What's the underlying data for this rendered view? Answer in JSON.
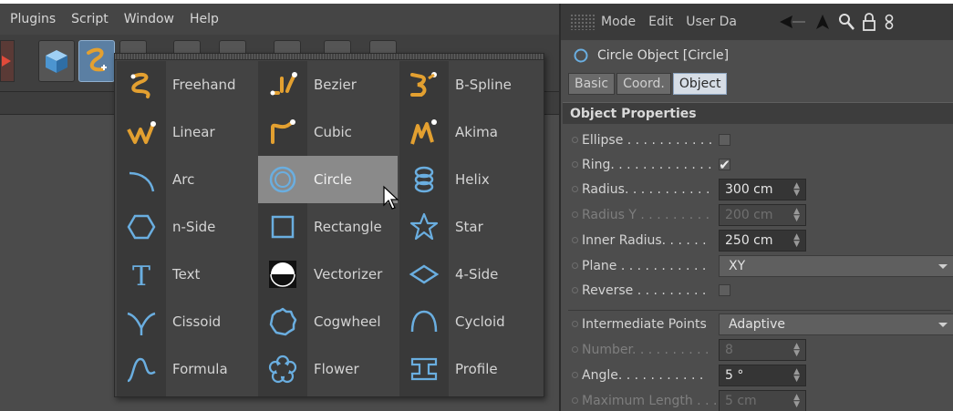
{
  "menubar": {
    "items": [
      "Plugins",
      "Script",
      "Window",
      "Help"
    ]
  },
  "spline_menu": {
    "columns": [
      {
        "items": [
          {
            "label": "Freehand",
            "icon": "freehand-spline-icon"
          },
          {
            "label": "Linear",
            "icon": "linear-spline-icon"
          },
          {
            "label": "Arc",
            "icon": "arc-icon"
          },
          {
            "label": "n-Side",
            "icon": "n-side-icon"
          },
          {
            "label": "Text",
            "icon": "text-icon"
          },
          {
            "label": "Cissoid",
            "icon": "cissoid-icon"
          },
          {
            "label": "Formula",
            "icon": "formula-icon"
          }
        ]
      },
      {
        "items": [
          {
            "label": "Bezier",
            "icon": "bezier-spline-icon"
          },
          {
            "label": "Cubic",
            "icon": "cubic-spline-icon"
          },
          {
            "label": "Circle",
            "icon": "circle-icon",
            "hovered": true
          },
          {
            "label": "Rectangle",
            "icon": "rectangle-icon"
          },
          {
            "label": "Vectorizer",
            "icon": "vectorizer-icon"
          },
          {
            "label": "Cogwheel",
            "icon": "cogwheel-icon"
          },
          {
            "label": "Flower",
            "icon": "flower-icon"
          }
        ]
      },
      {
        "items": [
          {
            "label": "B-Spline",
            "icon": "b-spline-icon"
          },
          {
            "label": "Akima",
            "icon": "akima-spline-icon"
          },
          {
            "label": "Helix",
            "icon": "helix-icon"
          },
          {
            "label": "Star",
            "icon": "star-icon"
          },
          {
            "label": "4-Side",
            "icon": "four-side-icon"
          },
          {
            "label": "Cycloid",
            "icon": "cycloid-icon"
          },
          {
            "label": "Profile",
            "icon": "profile-icon"
          }
        ]
      }
    ]
  },
  "attributes": {
    "header_menu": [
      "Mode",
      "Edit",
      "User Da"
    ],
    "object_title": "Circle Object [Circle]",
    "tabs": [
      {
        "label": "Basic",
        "active": false
      },
      {
        "label": "Coord.",
        "active": false
      },
      {
        "label": "Object",
        "active": true
      }
    ],
    "section_title": "Object Properties",
    "props": {
      "ellipse": {
        "label": "Ellipse . . . . . . . . . . .",
        "checked": false
      },
      "ring": {
        "label": "Ring. . . . . . . . . . . . .",
        "checked": true,
        "check_glyph": "✔"
      },
      "radius": {
        "label": "Radius. . . . . . . . . . .",
        "value": "300 cm"
      },
      "radius_y": {
        "label": "Radius Y . . . . . . . . .",
        "value": "200 cm",
        "disabled": true
      },
      "inner_radius": {
        "label": "Inner Radius. . . . . .",
        "value": "250 cm"
      },
      "plane": {
        "label": "Plane . . . . . . . . . . .",
        "value": "XY"
      },
      "reverse": {
        "label": "Reverse . . . . . . . . .",
        "checked": false
      },
      "intermediate": {
        "label": "Intermediate Points",
        "value": "Adaptive"
      },
      "number": {
        "label": "Number. . . . . . . . . .",
        "value": "8",
        "disabled": true
      },
      "angle": {
        "label": "Angle. . . . . . . . . . .",
        "value": "5 °"
      },
      "max_length": {
        "label": "Maximum Length . . .",
        "value": "5 cm",
        "disabled": true
      }
    }
  },
  "colors": {
    "accent": "#5b7fa3",
    "spline_orange": "#e3a030",
    "icon_blue": "#6aaee0",
    "hover": "#8a8a8a"
  }
}
